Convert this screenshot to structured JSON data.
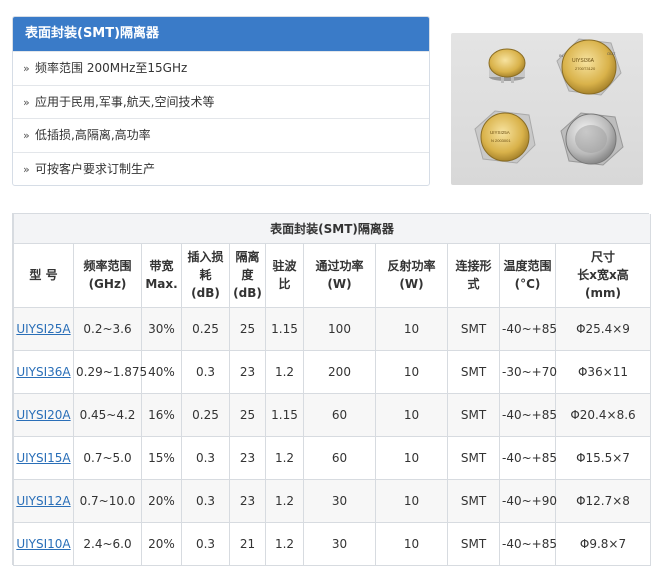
{
  "panel": {
    "title": "表面封装(SMT)隔离器",
    "features": [
      "频率范围 200MHz至15GHz",
      "应用于民用,军事,航天,空间技术等",
      "低插损,高隔离,高功率",
      "可按客户要求订制生产"
    ]
  },
  "photo": {
    "labels": [
      "UIYSI36A",
      "UIYSI25A",
      "2700T3120",
      "N 2003001",
      "IN",
      "OUT"
    ]
  },
  "table": {
    "title": "表面封装(SMT)隔离器",
    "headers": [
      [
        "型 号"
      ],
      [
        "频率范围",
        "(GHz)"
      ],
      [
        "带宽",
        "Max."
      ],
      [
        "插入损",
        "耗",
        "(dB)"
      ],
      [
        "隔离",
        "度",
        "(dB)"
      ],
      [
        "驻波",
        "比"
      ],
      [
        "通过功率",
        "(W)"
      ],
      [
        "反射功率",
        "(W)"
      ],
      [
        "连接形",
        "式"
      ],
      [
        "温度范围",
        "(°C)"
      ],
      [
        "尺寸",
        "长x宽x高",
        "(mm)"
      ]
    ],
    "rows": [
      [
        "UIYSI25A",
        "0.2~3.6",
        "30%",
        "0.25",
        "25",
        "1.15",
        "100",
        "10",
        "SMT",
        "-40~+85",
        "Φ25.4×9"
      ],
      [
        "UIYSI36A",
        "0.29~1.875",
        "40%",
        "0.3",
        "23",
        "1.2",
        "200",
        "10",
        "SMT",
        "-30~+70",
        "Φ36×11"
      ],
      [
        "UIYSI20A",
        "0.45~4.2",
        "16%",
        "0.25",
        "25",
        "1.15",
        "60",
        "10",
        "SMT",
        "-40~+85",
        "Φ20.4×8.6"
      ],
      [
        "UIYSI15A",
        "0.7~5.0",
        "15%",
        "0.3",
        "23",
        "1.2",
        "60",
        "10",
        "SMT",
        "-40~+85",
        "Φ15.5×7"
      ],
      [
        "UIYSI12A",
        "0.7~10.0",
        "20%",
        "0.3",
        "23",
        "1.2",
        "30",
        "10",
        "SMT",
        "-40~+90",
        "Φ12.7×8"
      ],
      [
        "UIYSI10A",
        "2.4~6.0",
        "20%",
        "0.3",
        "21",
        "1.2",
        "30",
        "10",
        "SMT",
        "-40~+85",
        "Φ9.8×7"
      ]
    ]
  },
  "colors": {
    "accent": "#3a7bc8",
    "link": "#2a6fb8",
    "border": "#d7dbe0"
  }
}
